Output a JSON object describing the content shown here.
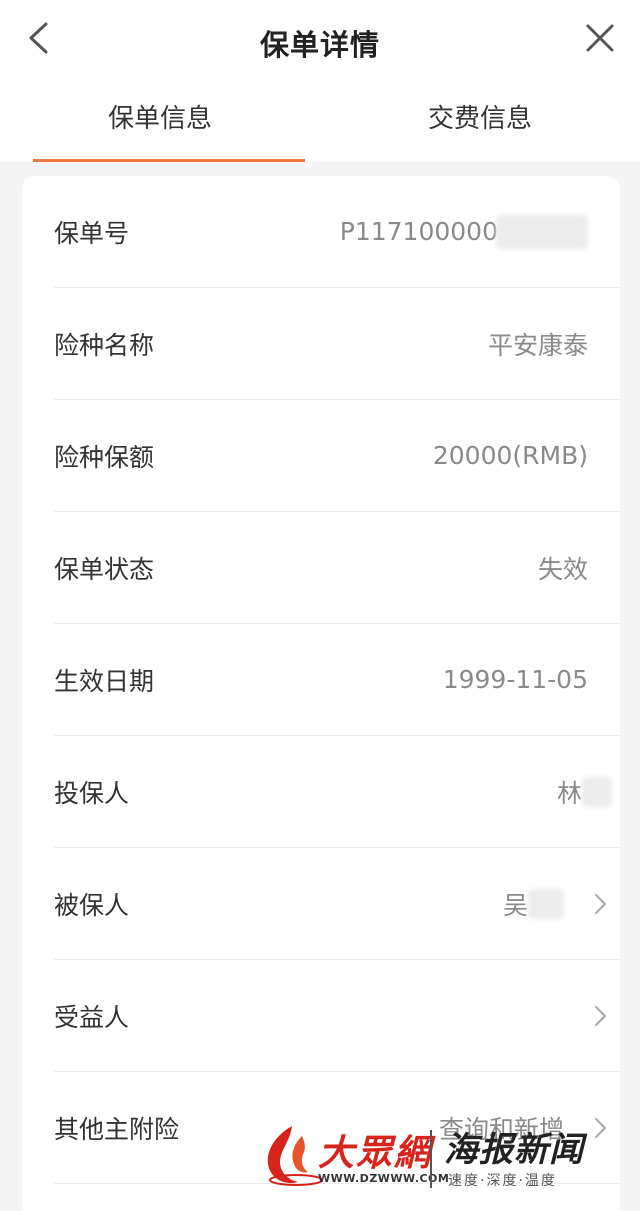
{
  "header": {
    "title": "保单详情"
  },
  "tabs": [
    {
      "label": "保单信息",
      "active": true
    },
    {
      "label": "交费信息",
      "active": false
    }
  ],
  "rows": [
    {
      "label": "保单号",
      "value": "P117100000"
    },
    {
      "label": "险种名称",
      "value": "平安康泰"
    },
    {
      "label": "险种保额",
      "value": "20000(RMB)"
    },
    {
      "label": "保单状态",
      "value": "失效"
    },
    {
      "label": "生效日期",
      "value": "1999-11-05"
    },
    {
      "label": "投保人",
      "value": "林"
    },
    {
      "label": "被保人",
      "value": "吴"
    },
    {
      "label": "受益人",
      "value": ""
    },
    {
      "label": "其他主附险",
      "value": "查询和新增"
    }
  ],
  "colors": {
    "accent": "#ef7a3b",
    "value_text": "#8a8a8a",
    "watermark_red": "#d8231a"
  },
  "icons": {
    "back": "chevron-left-icon",
    "close": "close-icon",
    "row_arrow": "chevron-right-icon"
  },
  "watermark": {
    "logo_text": "大眾網",
    "url": "WWW.DZWWW.COM",
    "brand": "海报新闻",
    "slogan": "速度·深度·温度"
  }
}
